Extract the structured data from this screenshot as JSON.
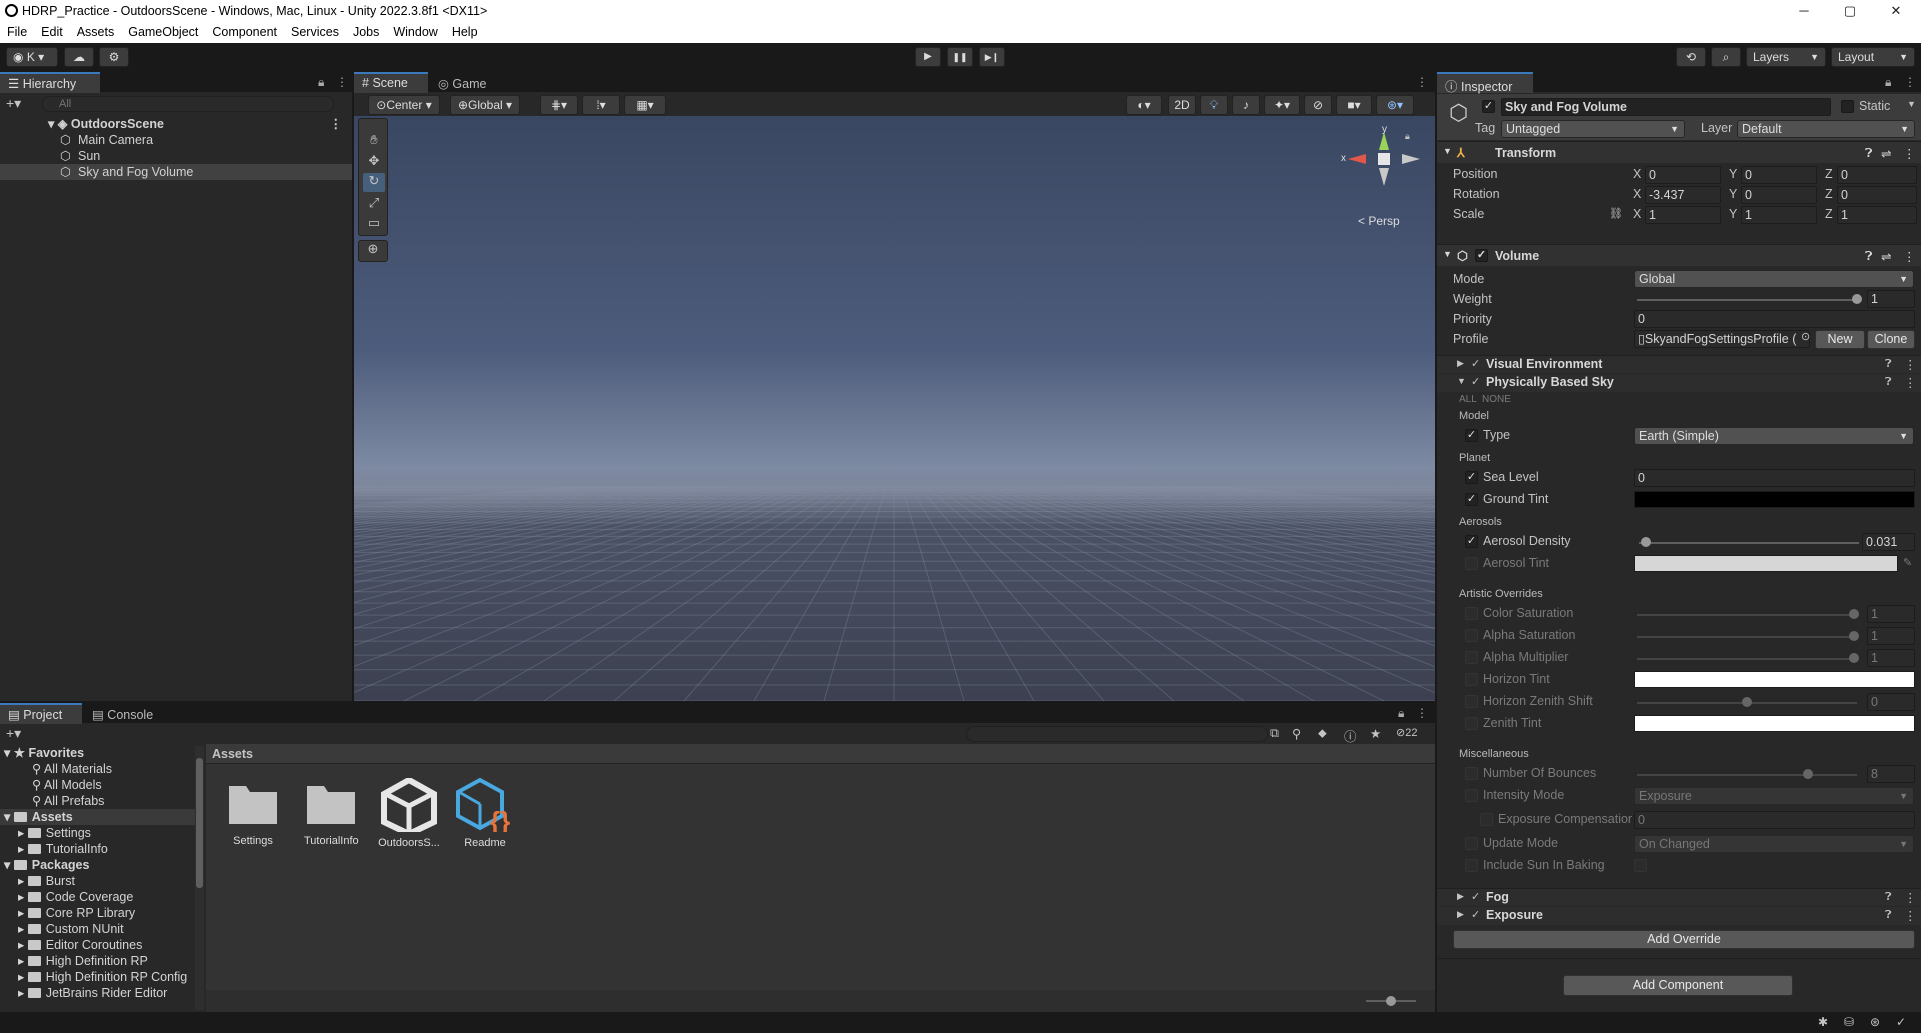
{
  "window": {
    "title": "HDRP_Practice - OutdoorsScene - Windows, Mac, Linux - Unity 2022.3.8f1 <DX11>",
    "min": "─",
    "max": "▢",
    "close": "✕"
  },
  "menu": [
    "File",
    "Edit",
    "Assets",
    "GameObject",
    "Component",
    "Services",
    "Jobs",
    "Window",
    "Help"
  ],
  "toolbar": {
    "account": "K",
    "layers": "Layers",
    "layout": "Layout",
    "play": "▶",
    "pause": "❚❚",
    "step": "▶❙"
  },
  "hierarchy": {
    "tab": "Hierarchy",
    "search_placeholder": "All",
    "scene": "OutdoorsScene",
    "items": [
      "Main Camera",
      "Sun",
      "Sky and Fog Volume"
    ]
  },
  "scene": {
    "tabs": [
      "Scene",
      "Game"
    ],
    "pivot": "Center",
    "space": "Global",
    "mode2d": "2D",
    "persp": "< Persp",
    "gizmo_y": "y",
    "gizmo_x": "x"
  },
  "inspector": {
    "tab": "Inspector",
    "object_name": "Sky and Fog Volume",
    "static": "Static",
    "tag_label": "Tag",
    "tag": "Untagged",
    "layer_label": "Layer",
    "layer": "Default",
    "transform": {
      "title": "Transform",
      "position": "Position",
      "rotation": "Rotation",
      "scale": "Scale",
      "pos": [
        "0",
        "0",
        "0"
      ],
      "rot": [
        "-3.437",
        "0",
        "0"
      ],
      "scl": [
        "1",
        "1",
        "1"
      ],
      "axes": [
        "X",
        "Y",
        "Z"
      ]
    },
    "volume": {
      "title": "Volume",
      "mode_label": "Mode",
      "mode": "Global",
      "weight_label": "Weight",
      "weight": "1",
      "priority_label": "Priority",
      "priority": "0",
      "profile_label": "Profile",
      "profile": "SkyandFogSettingsProfile (",
      "new": "New",
      "clone": "Clone"
    },
    "overrides": {
      "visual_env": "Visual Environment",
      "pbs": "Physically Based Sky",
      "all": "ALL",
      "none": "NONE",
      "model": "Model",
      "type_label": "Type",
      "type": "Earth (Simple)",
      "planet": "Planet",
      "sea_level_label": "Sea Level",
      "sea_level": "0",
      "ground_tint": "Ground Tint",
      "aerosols": "Aerosols",
      "aerosol_density_label": "Aerosol Density",
      "aerosol_density": "0.031",
      "aerosol_tint": "Aerosol Tint",
      "artistic": "Artistic Overrides",
      "color_sat": "Color Saturation",
      "color_sat_v": "1",
      "alpha_sat": "Alpha Saturation",
      "alpha_sat_v": "1",
      "alpha_mul": "Alpha Multiplier",
      "alpha_mul_v": "1",
      "horizon_tint": "Horizon Tint",
      "horizon_shift": "Horizon Zenith Shift",
      "horizon_shift_v": "0",
      "zenith_tint": "Zenith Tint",
      "misc": "Miscellaneous",
      "bounces": "Number Of Bounces",
      "bounces_v": "8",
      "intensity_mode": "Intensity Mode",
      "intensity_mode_v": "Exposure",
      "exposure_comp": "Exposure Compensation",
      "exposure_comp_v": "0",
      "update_mode": "Update Mode",
      "update_mode_v": "On Changed",
      "include_sun": "Include Sun In Baking",
      "fog": "Fog",
      "exposure": "Exposure",
      "add_override": "Add Override"
    },
    "add_component": "Add Component"
  },
  "project": {
    "tabs": [
      "Project",
      "Console"
    ],
    "breadcrumb": "Assets",
    "hidden_count": "22",
    "favorites": "Favorites",
    "fav_items": [
      "All Materials",
      "All Models",
      "All Prefabs"
    ],
    "assets_root": "Assets",
    "asset_folders": [
      "Settings",
      "TutorialInfo"
    ],
    "packages_root": "Packages",
    "packages": [
      "Burst",
      "Code Coverage",
      "Core RP Library",
      "Custom NUnit",
      "Editor Coroutines",
      "High Definition RP",
      "High Definition RP Config",
      "JetBrains Rider Editor"
    ],
    "grid": [
      {
        "name": "Settings",
        "kind": "folder"
      },
      {
        "name": "TutorialInfo",
        "kind": "folder"
      },
      {
        "name": "OutdoorsS...",
        "kind": "unity"
      },
      {
        "name": "Readme",
        "kind": "readme"
      }
    ]
  },
  "colors": {
    "accent": "#3a79bb",
    "panel": "#282828",
    "dark": "#191919"
  }
}
